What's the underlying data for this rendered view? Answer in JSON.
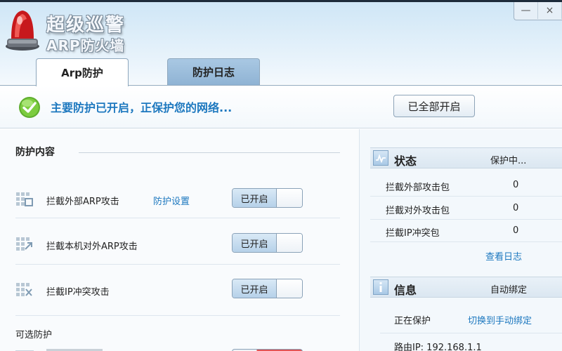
{
  "app": {
    "title": "超级巡警",
    "subtitle": "ARP防火墙",
    "window_controls": {
      "minimize": "—",
      "close": "×"
    }
  },
  "tabs": [
    {
      "label": "Arp防护",
      "active": true
    },
    {
      "label": "防护日志",
      "active": false
    }
  ],
  "banner": {
    "status_text": "主要防护已开启，正保护您的网络...",
    "all_on_button": "已全部开启",
    "icon": "check-circle-icon"
  },
  "protection": {
    "section_title": "防护内容",
    "items": [
      {
        "label": "拦截外部ARP攻击",
        "link": "防护设置",
        "toggle_label": "已开启",
        "enabled": true,
        "icon": "shield-grid-icon"
      },
      {
        "label": "拦截本机对外ARP攻击",
        "toggle_label": "已开启",
        "enabled": true,
        "icon": "outbound-grid-icon"
      },
      {
        "label": "拦截IP冲突攻击",
        "toggle_label": "已开启",
        "enabled": true,
        "icon": "conflict-grid-icon"
      }
    ],
    "optional_title": "可选防护"
  },
  "status_panel": {
    "title": "状态",
    "value": "保护中...",
    "icon": "pulse-chart-icon",
    "stats": [
      {
        "label": "拦截外部攻击包",
        "value": "0"
      },
      {
        "label": "拦截对外攻击包",
        "value": "0"
      },
      {
        "label": "拦截IP冲突包",
        "value": "0"
      }
    ],
    "view_log_link": "查看日志"
  },
  "info_panel": {
    "title": "信息",
    "value": "自动绑定",
    "icon": "info-icon",
    "protecting_label": "正在保护",
    "switch_link": "切换到手动绑定",
    "gateway": "路由IP: 192.168.1.1"
  },
  "colors": {
    "accent_blue": "#1d78bf",
    "header_bg": "#cfe6f6",
    "tab_inactive": "#a9c8e3",
    "toggle_on": "#b6d1e9"
  }
}
